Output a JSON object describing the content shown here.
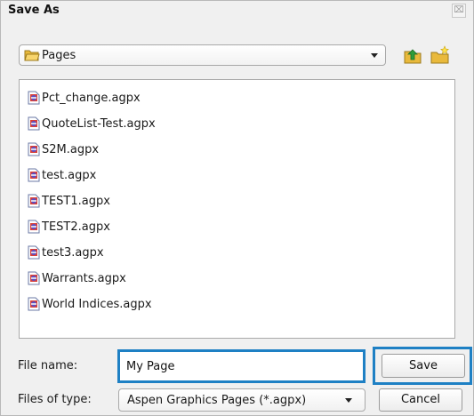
{
  "dialog": {
    "title": "Save As",
    "close_glyph": "⌧"
  },
  "location": {
    "folder": "Pages",
    "icon": "open-folder-icon"
  },
  "toolbar": {
    "up_icon": "folder-up-icon",
    "new_folder_icon": "new-folder-icon"
  },
  "files": [
    {
      "name": "Pct_change.agpx"
    },
    {
      "name": "QuoteList-Test.agpx"
    },
    {
      "name": "S2M.agpx"
    },
    {
      "name": "test.agpx"
    },
    {
      "name": "TEST1.agpx"
    },
    {
      "name": "TEST2.agpx"
    },
    {
      "name": "test3.agpx"
    },
    {
      "name": "Warrants.agpx"
    },
    {
      "name": "World Indices.agpx"
    }
  ],
  "file_name": {
    "label": "File name:",
    "value": "My Page"
  },
  "file_type": {
    "label": "Files of type:",
    "selected": "Aspen Graphics Pages (*.agpx)"
  },
  "buttons": {
    "save": "Save",
    "cancel": "Cancel"
  },
  "colors": {
    "focus_border": "#1e80c4",
    "dialog_bg": "#f0f0f0",
    "folder_yellow": "#f5c542"
  }
}
